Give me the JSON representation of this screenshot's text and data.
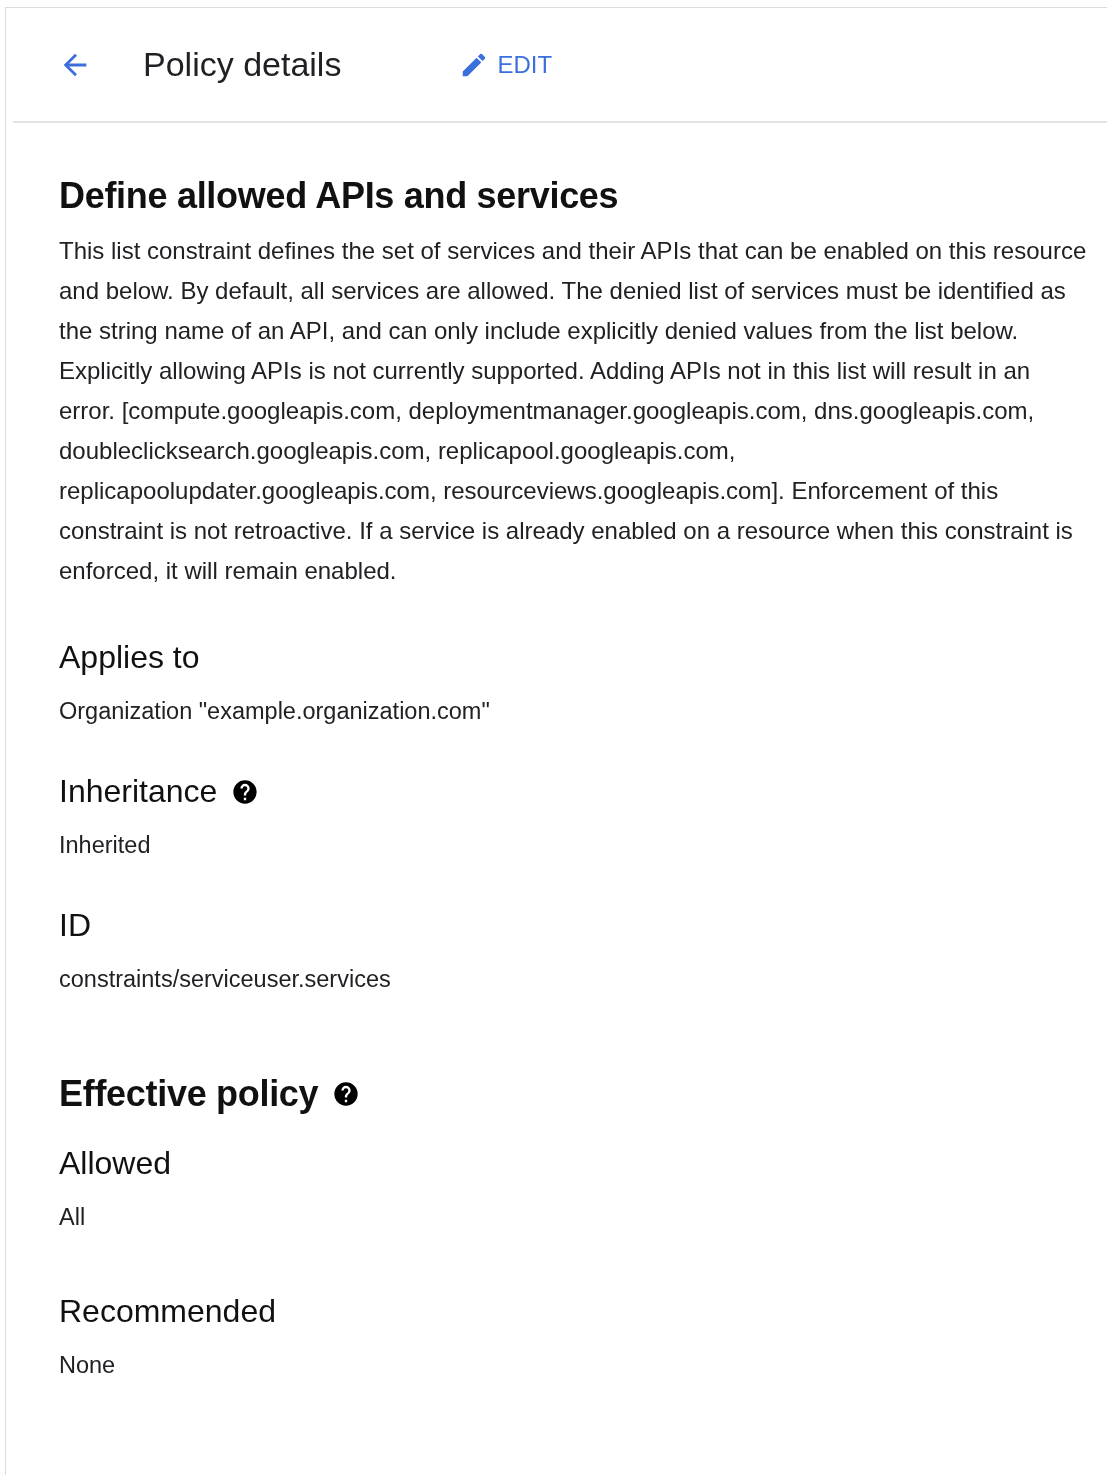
{
  "header": {
    "title": "Policy details",
    "edit_label": "EDIT"
  },
  "constraint": {
    "title": "Define allowed APIs and services",
    "description": "This list constraint defines the set of services and their APIs that can be enabled on this resource and below. By default, all services are allowed. The denied list of services must be identified as the string name of an API, and can only include explicitly denied values from the list below. Explicitly allowing APIs is not currently supported. Adding APIs not in this list will result in an error. [compute.googleapis.com, deploymentmanager.googleapis.com, dns.googleapis.com, doubleclicksearch.googleapis.com, replicapool.googleapis.com, replicapoolupdater.googleapis.com, resourceviews.googleapis.com]. Enforcement of this constraint is not retroactive. If a service is already enabled on a resource when this constraint is enforced, it will remain enabled."
  },
  "details": [
    {
      "label": "Applies to",
      "value": "Organization \"example.organization.com\"",
      "help": false
    },
    {
      "label": "Inheritance",
      "value": "Inherited",
      "help": true
    },
    {
      "label": "ID",
      "value": "constraints/serviceuser.services",
      "help": false
    }
  ],
  "effective_policy": {
    "title": "Effective policy",
    "help": true,
    "items": [
      {
        "label": "Allowed",
        "value": "All"
      },
      {
        "label": "Recommended",
        "value": "None"
      }
    ]
  }
}
